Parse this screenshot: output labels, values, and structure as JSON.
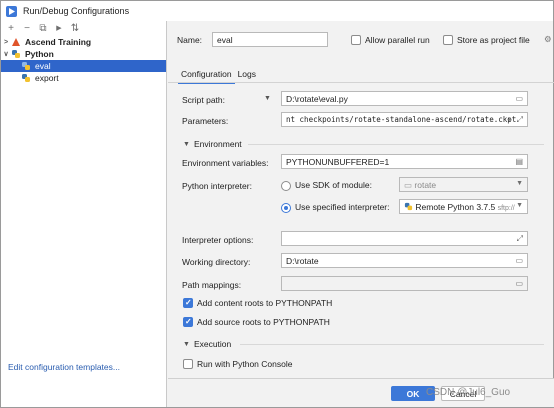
{
  "window": {
    "title": "Run/Debug Configurations"
  },
  "toolbar": {
    "add": "+",
    "remove": "−",
    "copy": "⧉",
    "move": "▶",
    "sort": "⇅"
  },
  "tree": {
    "items": [
      {
        "label": "Ascend Training",
        "level": 0,
        "expanded": false
      },
      {
        "label": "Python",
        "level": 0,
        "expanded": true
      },
      {
        "label": "eval",
        "level": 1,
        "selected": true
      },
      {
        "label": "export",
        "level": 1,
        "selected": false
      }
    ]
  },
  "edit_templates_link": "Edit configuration templates...",
  "form": {
    "name_label": "Name:",
    "name_value": "eval",
    "allow_parallel_label": "Allow parallel run",
    "store_project_label": "Store as project file",
    "tabs": [
      "Configuration",
      "Logs"
    ],
    "script_path_label": "Script path:",
    "script_path_value": "D:\\rotate\\eval.py",
    "parameters_label": "Parameters:",
    "parameters_value": "nt checkpoints/rotate-standalone-ascend/rotate.ckpt",
    "environment_section": "Environment",
    "env_vars_label": "Environment variables:",
    "env_vars_value": "PYTHONUNBUFFERED=1",
    "python_interpreter_label": "Python interpreter:",
    "use_sdk_label": "Use SDK of module:",
    "sdk_module_value": "rotate",
    "use_specified_label": "Use specified interpreter:",
    "interpreter_value": "Remote Python 3.7.5",
    "interpreter_suffix": "sftp://",
    "interpreter_options_label": "Interpreter options:",
    "working_dir_label": "Working directory:",
    "working_dir_value": "D:\\rotate",
    "path_mappings_label": "Path mappings:",
    "add_content_roots_label": "Add content roots to PYTHONPATH",
    "add_source_roots_label": "Add source roots to PYTHONPATH",
    "execution_section": "Execution",
    "run_console_label": "Run with Python Console"
  },
  "buttons": {
    "ok": "OK",
    "cancel": "Cancel"
  },
  "watermark": "CSDN @Jul6_Guo",
  "colors": {
    "accent": "#3c78d8",
    "selection": "#2f65ca",
    "link": "#2a5db0"
  }
}
